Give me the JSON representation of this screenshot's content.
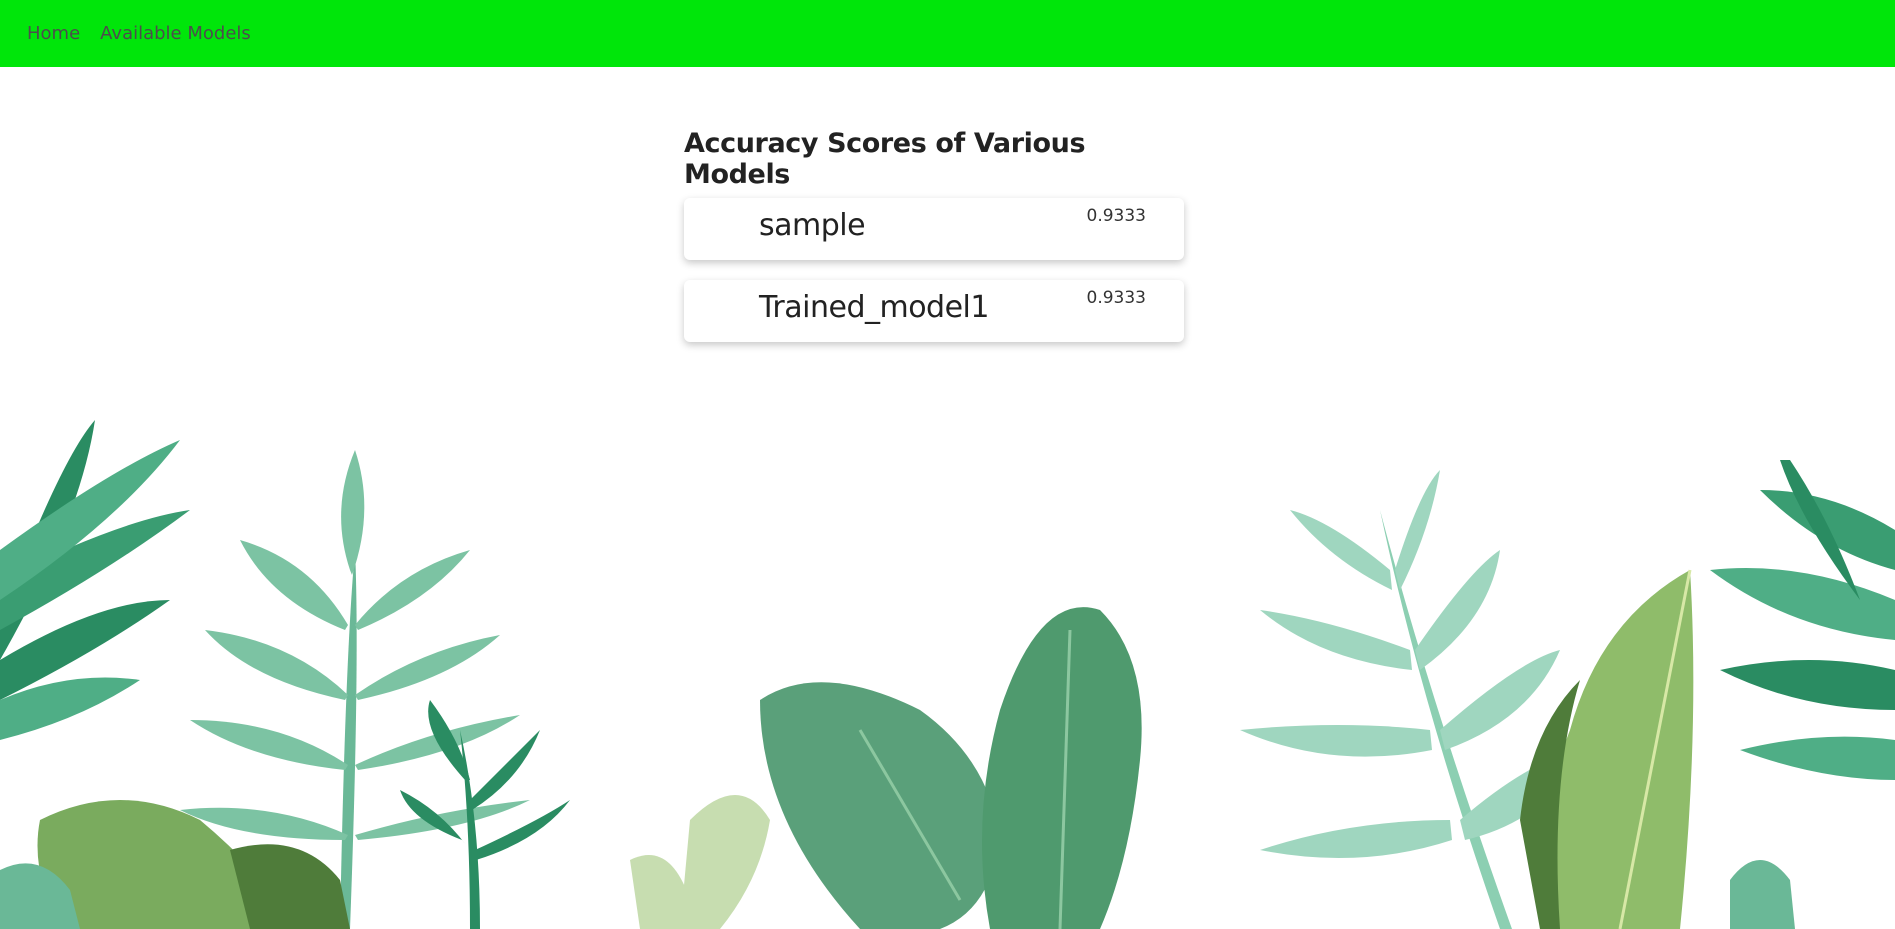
{
  "nav": {
    "links": [
      {
        "label": "Home"
      },
      {
        "label": "Available Models"
      }
    ]
  },
  "main": {
    "title": "Accuracy Scores of Various Models",
    "models": [
      {
        "name": "sample",
        "score": "0.9333"
      },
      {
        "name": "Trained_model1",
        "score": "0.9333"
      }
    ]
  },
  "colors": {
    "navbar": "#00e60a",
    "leaf_dark": "#2a8c62",
    "leaf_mid": "#4fae86",
    "leaf_light": "#8fd0b4",
    "leaf_olive": "#7aab5e",
    "leaf_pale": "#c7ddb0"
  }
}
